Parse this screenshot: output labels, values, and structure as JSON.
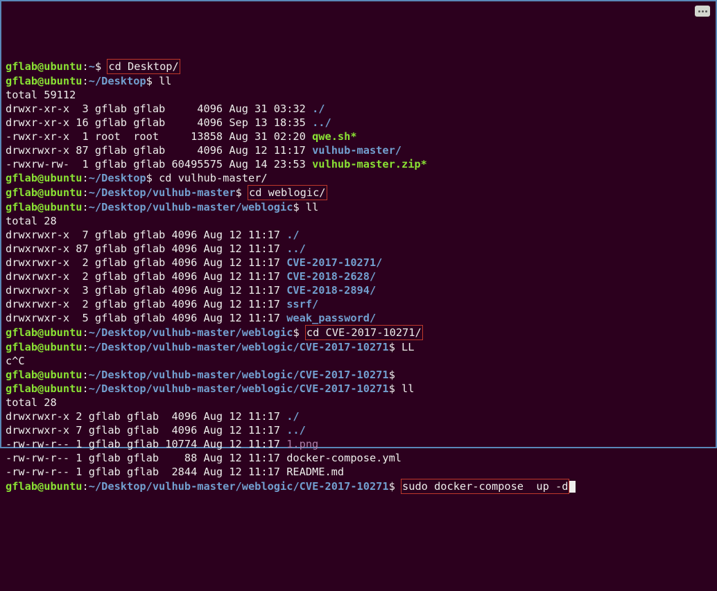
{
  "user": "gflab@ubuntu",
  "home": "~",
  "paths": {
    "desktop": "~/Desktop",
    "vulhub": "~/Desktop/vulhub-master",
    "weblogic": "~/Desktop/vulhub-master/weblogic",
    "cve": "~/Desktop/vulhub-master/weblogic/CVE-2017-10271"
  },
  "cmds": {
    "cd_desktop": "cd Desktop/",
    "ll1": "ll",
    "cd_vulhub": "cd vulhub-master/",
    "cd_weblogic": "cd weblogic/",
    "ll2": "ll",
    "cd_cve": "cd CVE-2017-10271/",
    "LL": "LL",
    "ctrl_c": "c^C",
    "empty": "",
    "ll3": "ll",
    "sudo": "sudo docker-compose  up -d"
  },
  "ll_desktop": {
    "total": "total 59112",
    "rows": [
      {
        "perm": "drwxr-xr-x",
        "n": "3",
        "own": "gflab",
        "grp": "gflab",
        "size": "4096",
        "date": "Aug 31 03:32",
        "name": "./",
        "cls": "dir"
      },
      {
        "perm": "drwxr-xr-x",
        "n": "16",
        "own": "gflab",
        "grp": "gflab",
        "size": "4096",
        "date": "Sep 13 18:35",
        "name": "../",
        "cls": "dir"
      },
      {
        "perm": "-rwxr-xr-x",
        "n": "1",
        "own": "root",
        "grp": "root",
        "size": "13858",
        "date": "Aug 31 02:20",
        "name": "qwe.sh*",
        "cls": "exec"
      },
      {
        "perm": "drwxrwxr-x",
        "n": "87",
        "own": "gflab",
        "grp": "gflab",
        "size": "4096",
        "date": "Aug 12 11:17",
        "name": "vulhub-master/",
        "cls": "dir"
      },
      {
        "perm": "-rwxrw-rw-",
        "n": "1",
        "own": "gflab",
        "grp": "gflab",
        "size": "60495575",
        "date": "Aug 14 23:53",
        "name": "vulhub-master.zip*",
        "cls": "exec"
      }
    ]
  },
  "ll_weblogic": {
    "total": "total 28",
    "rows": [
      {
        "perm": "drwxrwxr-x",
        "n": "7",
        "own": "gflab",
        "grp": "gflab",
        "size": "4096",
        "date": "Aug 12 11:17",
        "name": "./",
        "cls": "dir"
      },
      {
        "perm": "drwxrwxr-x",
        "n": "87",
        "own": "gflab",
        "grp": "gflab",
        "size": "4096",
        "date": "Aug 12 11:17",
        "name": "../",
        "cls": "dir"
      },
      {
        "perm": "drwxrwxr-x",
        "n": "2",
        "own": "gflab",
        "grp": "gflab",
        "size": "4096",
        "date": "Aug 12 11:17",
        "name": "CVE-2017-10271/",
        "cls": "dir"
      },
      {
        "perm": "drwxrwxr-x",
        "n": "2",
        "own": "gflab",
        "grp": "gflab",
        "size": "4096",
        "date": "Aug 12 11:17",
        "name": "CVE-2018-2628/",
        "cls": "dir"
      },
      {
        "perm": "drwxrwxr-x",
        "n": "3",
        "own": "gflab",
        "grp": "gflab",
        "size": "4096",
        "date": "Aug 12 11:17",
        "name": "CVE-2018-2894/",
        "cls": "dir"
      },
      {
        "perm": "drwxrwxr-x",
        "n": "2",
        "own": "gflab",
        "grp": "gflab",
        "size": "4096",
        "date": "Aug 12 11:17",
        "name": "ssrf/",
        "cls": "dir"
      },
      {
        "perm": "drwxrwxr-x",
        "n": "5",
        "own": "gflab",
        "grp": "gflab",
        "size": "4096",
        "date": "Aug 12 11:17",
        "name": "weak_password/",
        "cls": "dir"
      }
    ]
  },
  "ll_cve": {
    "total": "total 28",
    "rows": [
      {
        "perm": "drwxrwxr-x",
        "n": "2",
        "own": "gflab",
        "grp": "gflab",
        "size": "4096",
        "date": "Aug 12 11:17",
        "name": "./",
        "cls": "dir"
      },
      {
        "perm": "drwxrwxr-x",
        "n": "7",
        "own": "gflab",
        "grp": "gflab",
        "size": "4096",
        "date": "Aug 12 11:17",
        "name": "../",
        "cls": "dir"
      },
      {
        "perm": "-rw-rw-r--",
        "n": "1",
        "own": "gflab",
        "grp": "gflab",
        "size": "10774",
        "date": "Aug 12 11:17",
        "name": "1.png",
        "cls": "pink"
      },
      {
        "perm": "-rw-rw-r--",
        "n": "1",
        "own": "gflab",
        "grp": "gflab",
        "size": "88",
        "date": "Aug 12 11:17",
        "name": "docker-compose.yml",
        "cls": ""
      },
      {
        "perm": "-rw-rw-r--",
        "n": "1",
        "own": "gflab",
        "grp": "gflab",
        "size": "2844",
        "date": "Aug 12 11:17",
        "name": "README.md",
        "cls": ""
      }
    ]
  }
}
